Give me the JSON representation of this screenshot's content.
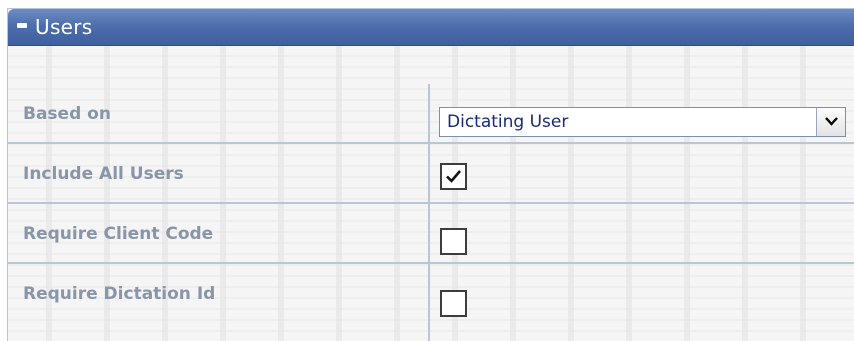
{
  "panel": {
    "title": "Users",
    "header_color": "#4d6fae",
    "collapse_icon": "minus-icon"
  },
  "fields": {
    "based_on": {
      "label": "Based on",
      "selected": "Dictating User",
      "dropdown_icon": "chevron-down-icon"
    },
    "include_all_users": {
      "label": "Include All Users",
      "checked": true
    },
    "require_client_code": {
      "label": "Require Client Code",
      "checked": false
    },
    "require_dictation_id": {
      "label": "Require Dictation Id",
      "checked": false
    }
  }
}
